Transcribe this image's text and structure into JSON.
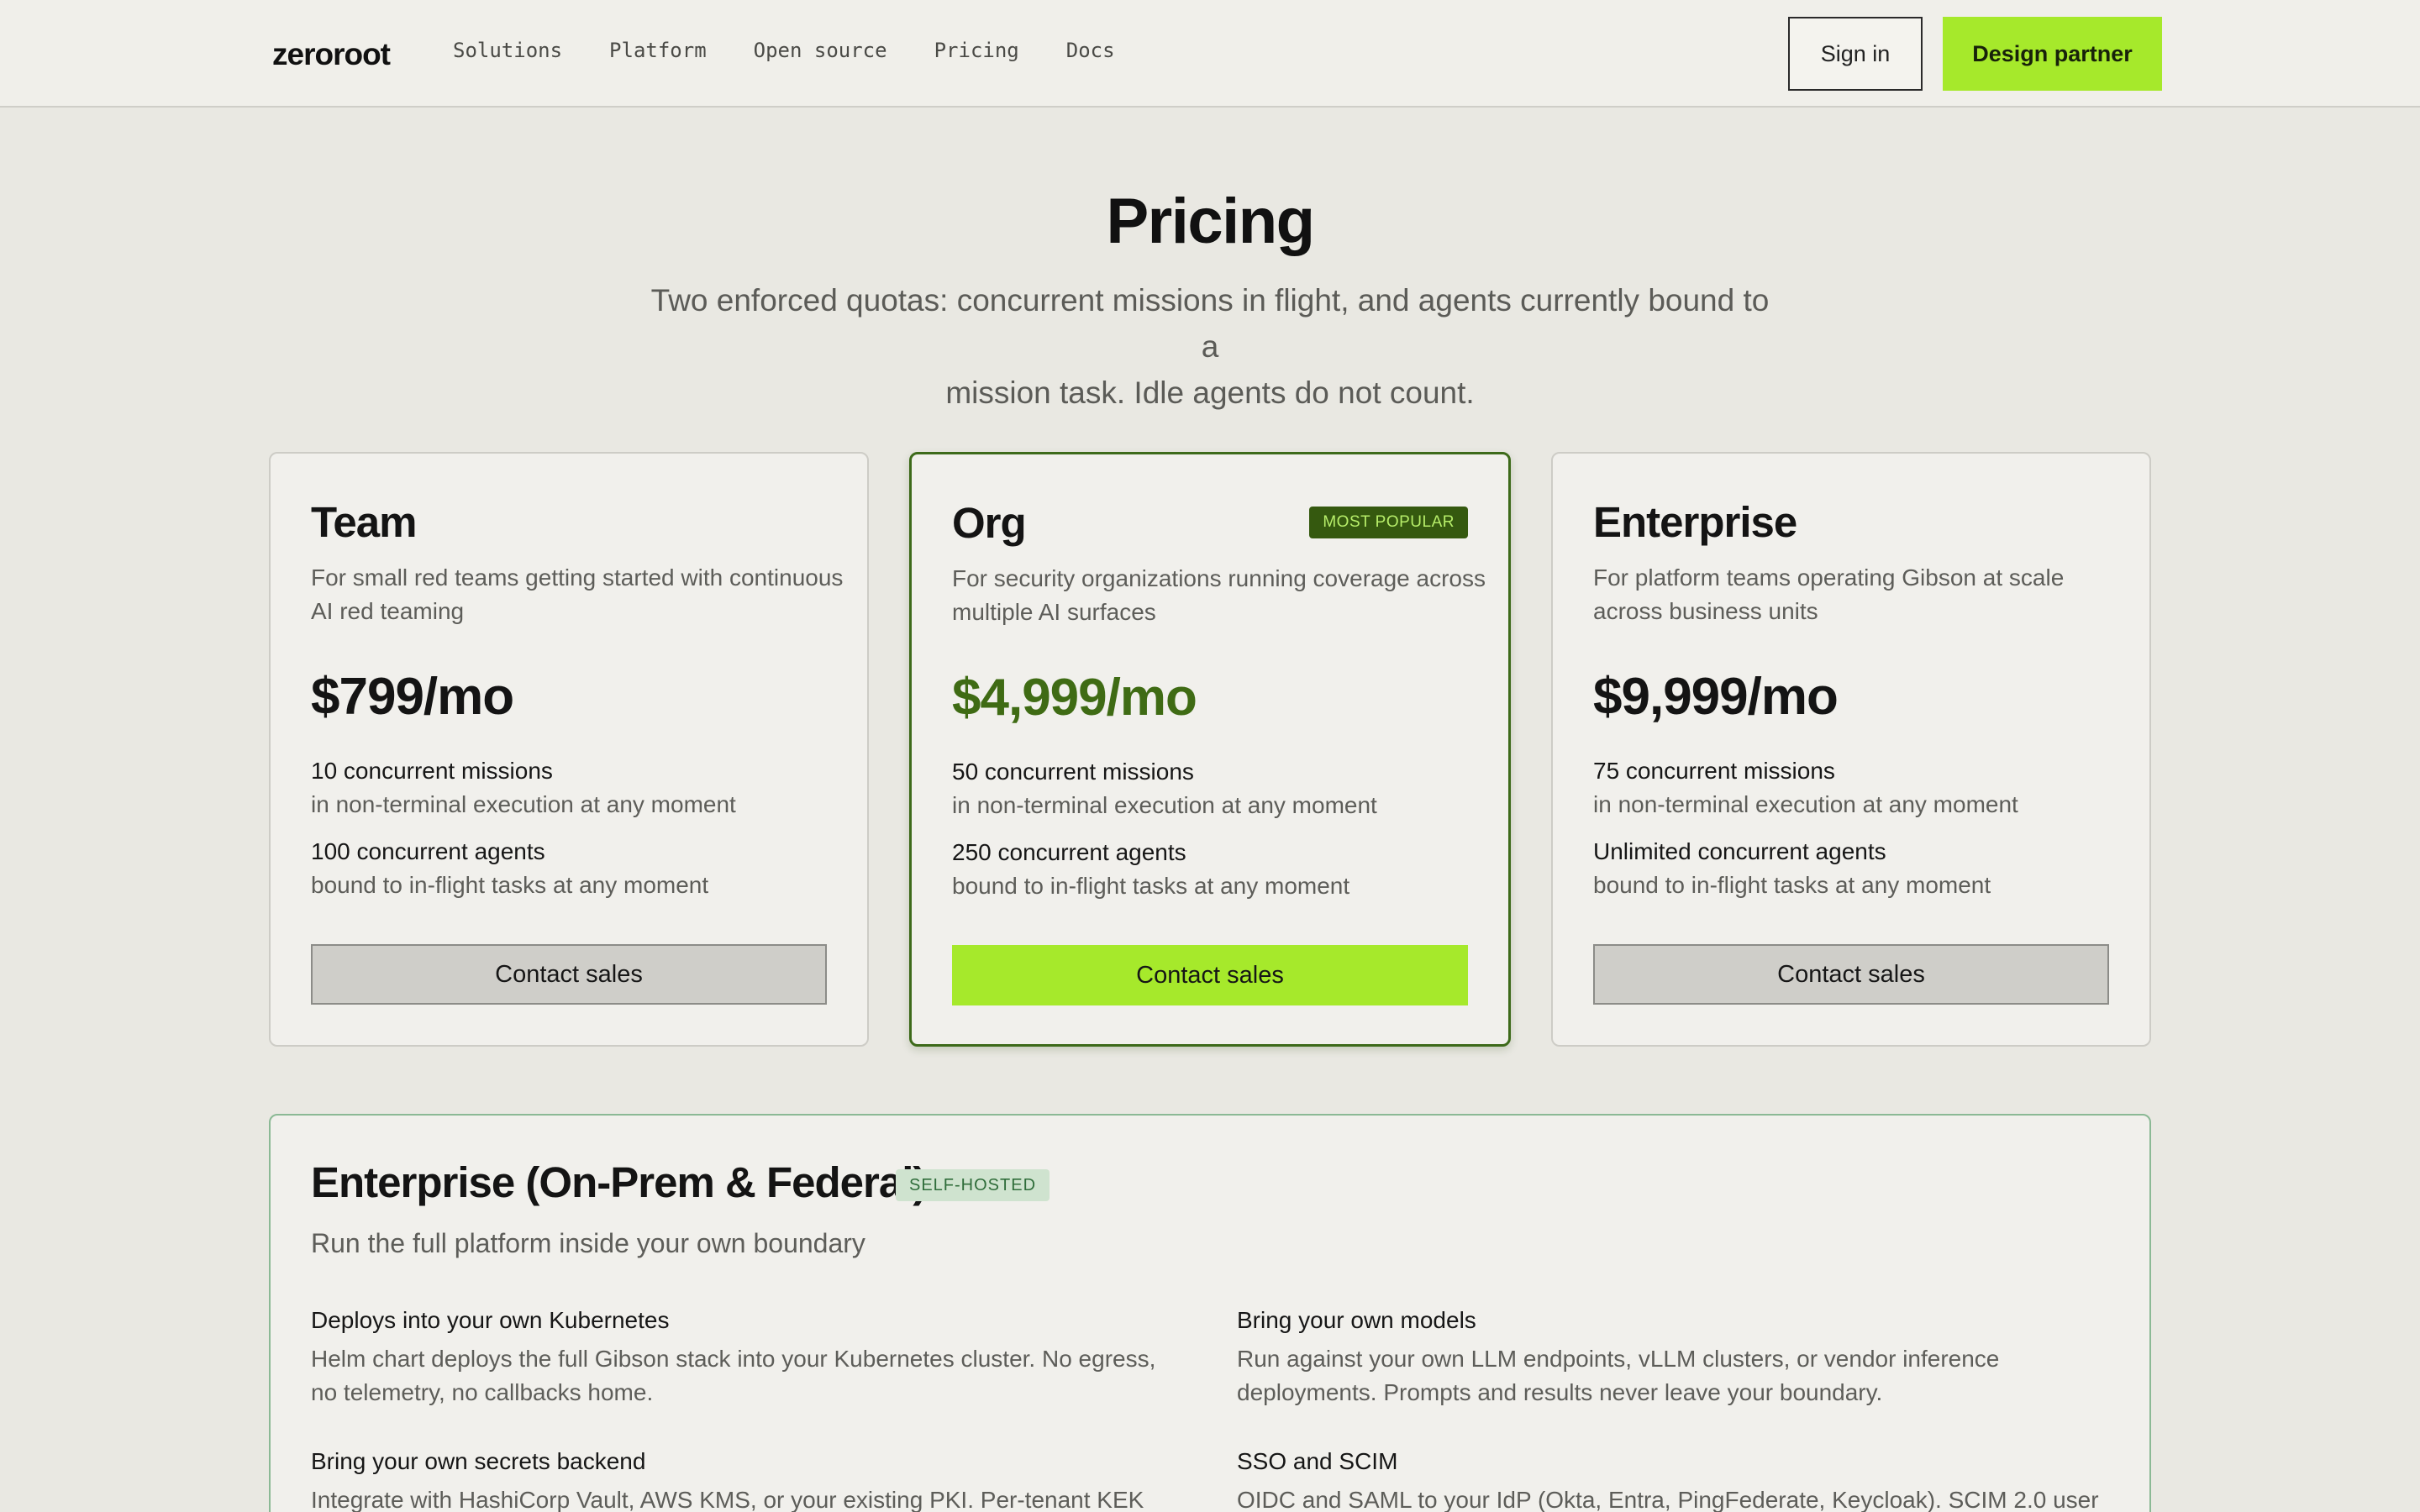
{
  "nav": {
    "logo": "zeroroot",
    "links": [
      "Solutions",
      "Platform",
      "Open source",
      "Pricing",
      "Docs"
    ],
    "signin": "Sign in",
    "partner": "Design partner"
  },
  "hero": {
    "title": "Pricing",
    "subtitle_line1": "Two enforced quotas: concurrent missions in flight, and agents currently bound to a",
    "subtitle_line2": "mission task. Idle agents do not count."
  },
  "plans": [
    {
      "name": "Team",
      "desc": "For small red teams getting started with continuous AI red teaming",
      "price": "$799/mo",
      "missions": "10 concurrent missions",
      "missions_sub": "in non-terminal execution at any moment",
      "agents": "100 concurrent agents",
      "agents_sub": "bound to in-flight tasks at any moment",
      "cta": "Contact sales"
    },
    {
      "name": "Org",
      "badge": "MOST POPULAR",
      "desc": "For security organizations running coverage across multiple AI surfaces",
      "price": "$4,999/mo",
      "missions": "50 concurrent missions",
      "missions_sub": "in non-terminal execution at any moment",
      "agents": "250 concurrent agents",
      "agents_sub": "bound to in-flight tasks at any moment",
      "cta": "Contact sales"
    },
    {
      "name": "Enterprise",
      "desc": "For platform teams operating Gibson at scale across business units",
      "price": "$9,999/mo",
      "missions": "75 concurrent missions",
      "missions_sub": "in non-terminal execution at any moment",
      "agents": "Unlimited concurrent agents",
      "agents_sub": "bound to in-flight tasks at any moment",
      "cta": "Contact sales"
    }
  ],
  "onprem": {
    "title": "Enterprise (On-Prem & Federal)",
    "badge": "SELF-HOSTED",
    "subtitle": "Run the full platform inside your own boundary",
    "features": [
      {
        "title": "Deploys into your own Kubernetes",
        "desc": "Helm chart deploys the full Gibson stack into your Kubernetes cluster. No egress, no telemetry, no callbacks home."
      },
      {
        "title": "Bring your own models",
        "desc": "Run against your own LLM endpoints, vLLM clusters, or vendor inference deployments. Prompts and results never leave your boundary."
      },
      {
        "title": "Bring your own secrets backend",
        "desc": "Integrate with HashiCorp Vault, AWS KMS, or your existing PKI. Per-tenant KEK"
      },
      {
        "title": "SSO and SCIM",
        "desc": "OIDC and SAML to your IdP (Okta, Entra, PingFederate, Keycloak). SCIM 2.0 user"
      }
    ]
  },
  "colors": {
    "accent": "#a6e92b",
    "featured_border": "#3d6a1a",
    "featured_price": "#3f6b14",
    "page_bg": "#e9e8e2"
  }
}
